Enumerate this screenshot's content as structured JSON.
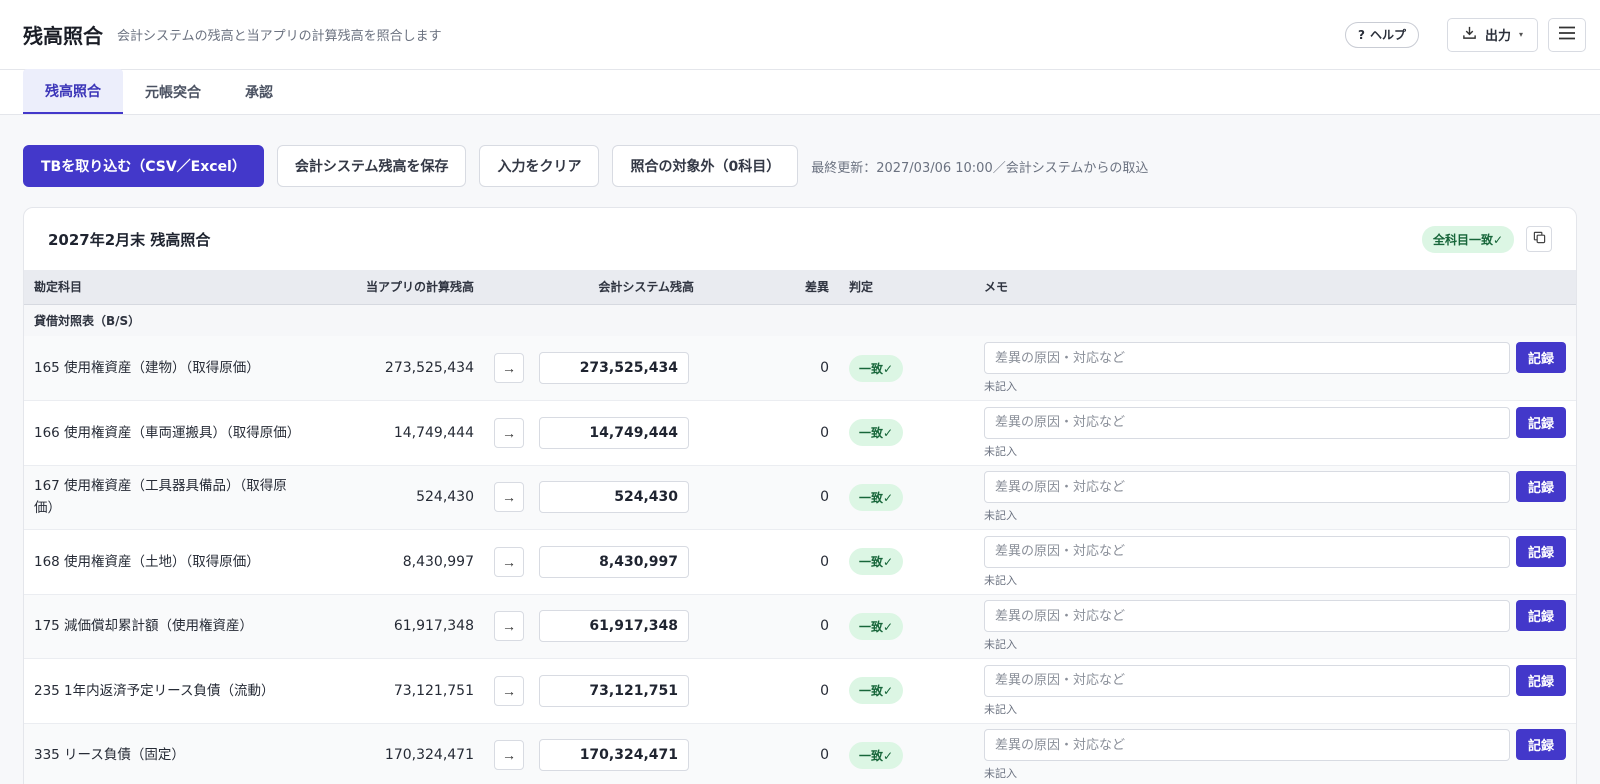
{
  "header": {
    "title": "残高照合",
    "subtitle": "会計システムの残高と当アプリの計算残高を照合します",
    "help_label": "ヘルプ",
    "help_icon": "?",
    "export_label": "出力",
    "export_caret": "▾"
  },
  "tabs": [
    {
      "label": "残高照合",
      "active": true
    },
    {
      "label": "元帳突合",
      "active": false
    },
    {
      "label": "承認",
      "active": false
    }
  ],
  "toolbar": {
    "import_label": "TBを取り込む（CSV／Excel）",
    "save_label": "会計システム残高を保存",
    "clear_label": "入力をクリア",
    "exclude_label": "照合の対象外（0科目）",
    "last_updated": "最終更新：2027/03/06 10:00／会計システムからの取込"
  },
  "card": {
    "title": "2027年2月末 残高照合",
    "all_match_label": "全科目一致✓"
  },
  "table": {
    "headers": {
      "account": "勘定科目",
      "calc": "当アプリの計算残高",
      "system": "会計システム残高",
      "diff": "差異",
      "judgement": "判定",
      "memo": "メモ"
    },
    "section_label": "貸借対照表（B/S）",
    "memo_placeholder": "差異の原因・対応など",
    "memo_note": "未記入",
    "record_label": "記録",
    "arrow": "→",
    "rows": [
      {
        "account": "165 使用権資産（建物）（取得原価）",
        "calc": "273,525,434",
        "system": "273,525,434",
        "diff": "0",
        "judgement": "一致✓"
      },
      {
        "account": "166 使用権資産（車両運搬具）（取得原価）",
        "calc": "14,749,444",
        "system": "14,749,444",
        "diff": "0",
        "judgement": "一致✓"
      },
      {
        "account": "167 使用権資産（工具器具備品）（取得原価）",
        "calc": "524,430",
        "system": "524,430",
        "diff": "0",
        "judgement": "一致✓"
      },
      {
        "account": "168 使用権資産（土地）（取得原価）",
        "calc": "8,430,997",
        "system": "8,430,997",
        "diff": "0",
        "judgement": "一致✓"
      },
      {
        "account": "175 減価償却累計額（使用権資産）",
        "calc": "61,917,348",
        "system": "61,917,348",
        "diff": "0",
        "judgement": "一致✓"
      },
      {
        "account": "235 1年内返済予定リース負債（流動）",
        "calc": "73,121,751",
        "system": "73,121,751",
        "diff": "0",
        "judgement": "一致✓"
      },
      {
        "account": "335 リース負債（固定）",
        "calc": "170,324,471",
        "system": "170,324,471",
        "diff": "0",
        "judgement": "一致✓"
      }
    ]
  },
  "icons": {
    "help": "question-icon",
    "export": "download-icon",
    "menu": "hamburger-menu-icon",
    "copy": "copy-icon"
  },
  "colors": {
    "primary": "#4338ca",
    "match_bg": "#dcf6e4",
    "match_text": "#17663a"
  }
}
